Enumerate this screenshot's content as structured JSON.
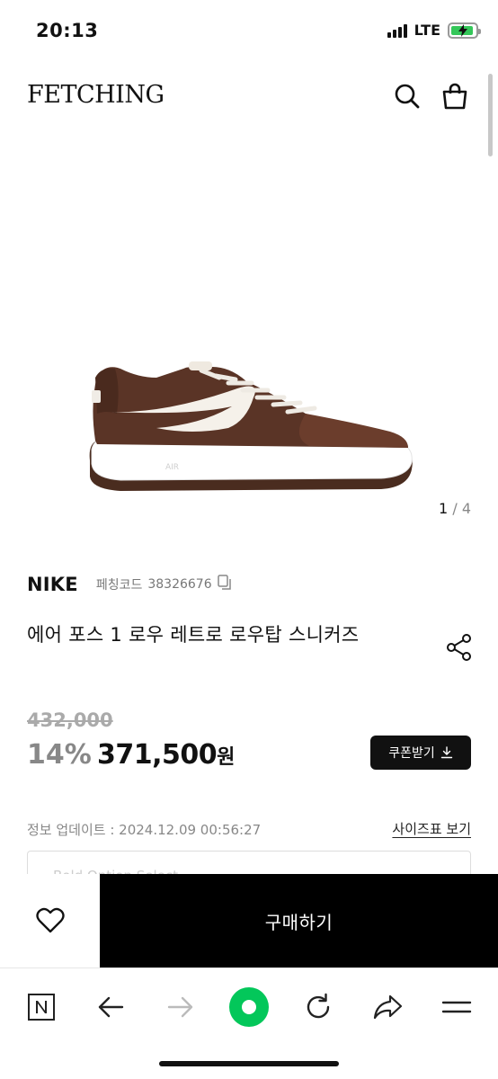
{
  "status_bar": {
    "time": "20:13",
    "network": "LTE"
  },
  "header": {
    "logo": "FETCHING",
    "icons": [
      "search-icon",
      "shopping-bag-icon"
    ]
  },
  "gallery": {
    "current": "1",
    "separator": "/",
    "total": "4"
  },
  "product": {
    "brand": "NIKE",
    "code_label": "페칭코드",
    "code_value": "38326676",
    "title": "에어 포스 1 로우 레트로 로우탑 스니커즈",
    "original_price": "432,000",
    "discount": "14%",
    "price": "371,500",
    "currency": "원",
    "coupon_label": "쿠폰받기",
    "update_info": "정보 업데이트 : 2024.12.09 00:56:27",
    "size_chart_label": "사이즈표 보기",
    "select_placeholder": "Bold Option Select"
  },
  "buy_bar": {
    "wishlist_icon": "heart-icon",
    "buy_label": "구매하기"
  },
  "browser_toolbar": {
    "icons": [
      "naver-n-icon",
      "back-arrow-icon",
      "forward-arrow-icon",
      "green-dot-icon",
      "reload-icon",
      "share-arrow-icon",
      "menu-icon"
    ]
  },
  "colors": {
    "accent_green": "#03C75A",
    "black": "#000000",
    "battery_green": "#34C759"
  }
}
